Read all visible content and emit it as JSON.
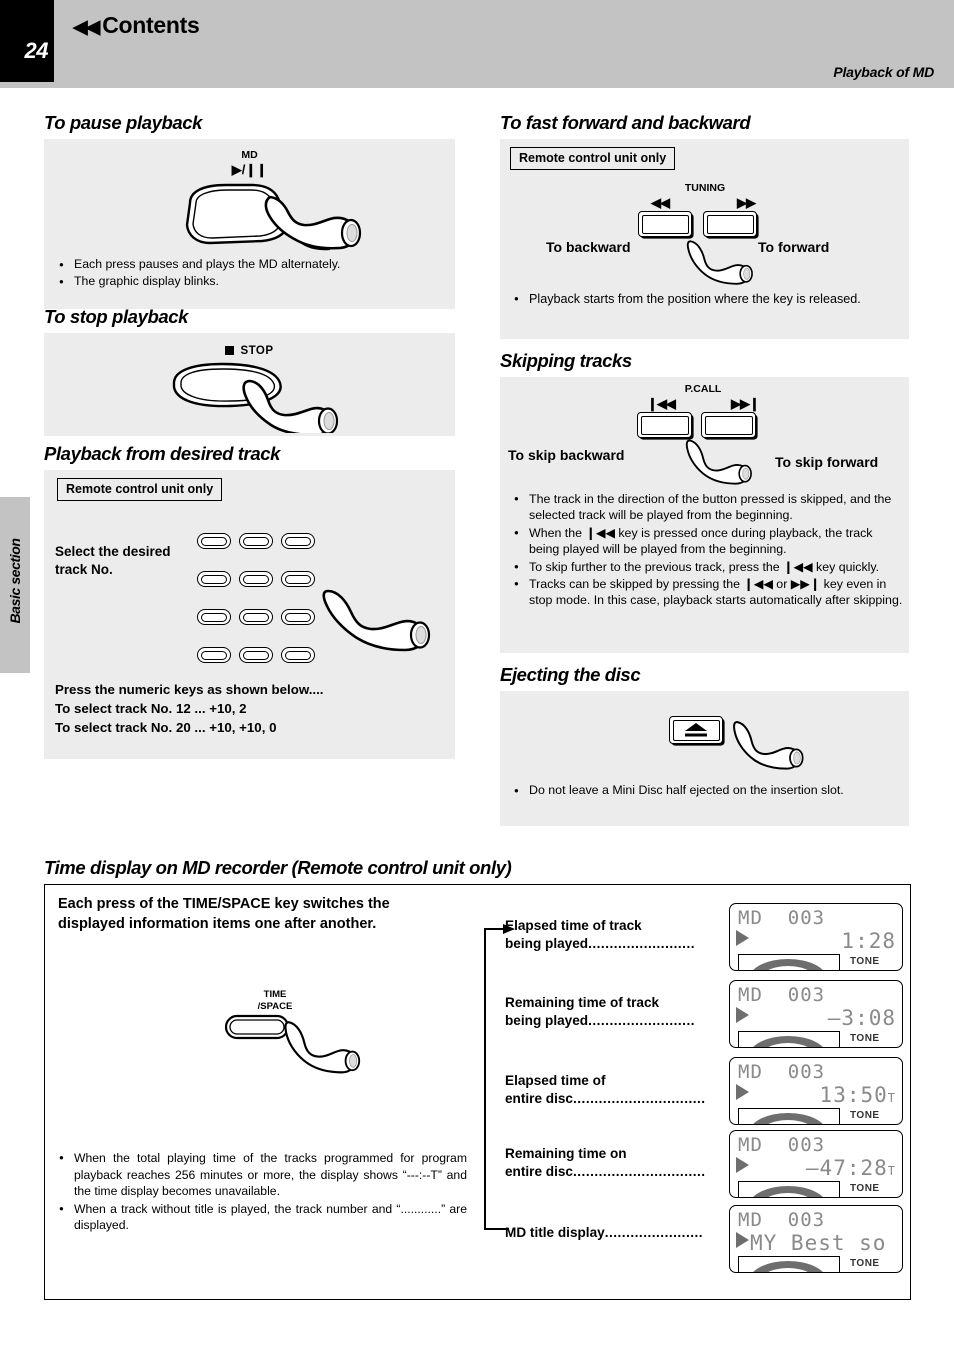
{
  "header": {
    "page_number": "24",
    "back_icon": "rewind-icon",
    "contents_label": "Contents",
    "section_title": "Playback of MD"
  },
  "side_tab": {
    "label": "Basic section"
  },
  "sections": {
    "pause": {
      "heading": "To pause playback",
      "button_top_label": "MD",
      "button_sub_label": "▶/❙❙",
      "bullets": [
        "Each press pauses and plays the MD alternately.",
        "The graphic display blinks."
      ]
    },
    "stop": {
      "heading": "To stop playback",
      "button_label": "STOP",
      "button_icon": "stop-square-icon"
    },
    "desired_track": {
      "heading": "Playback from desired track",
      "badge": "Remote control unit only",
      "select_label_line1": "Select the desired",
      "select_label_line2": "track No.",
      "note_line1": "Press the numeric keys as shown below....",
      "note_line2": "To select track No. 12 ... +10, 2",
      "note_line3": "To select track No. 20 ... +10, +10, 0",
      "keypad_rows": 4,
      "keypad_cols": 3
    },
    "fast_forward": {
      "heading": "To fast forward and backward",
      "badge": "Remote control unit only",
      "group_label": "TUNING",
      "left_icon": "◀◀",
      "right_icon": "▶▶",
      "left_label": "To backward",
      "right_label": "To forward",
      "bullets": [
        "Playback starts from the position where the key is released."
      ]
    },
    "skipping": {
      "heading": "Skipping tracks",
      "group_label": "P.CALL",
      "left_icon": "❙◀◀",
      "right_icon": "▶▶❙",
      "left_label": "To skip backward",
      "right_label": "To skip forward",
      "bullets": [
        "The track in the direction of the button pressed is skipped, and the selected track will be played from  the beginning.",
        "When the ❙◀◀ key is pressed once during playback, the track being played will be played from the beginning.",
        "To skip further to the previous track, press the ❙◀◀ key quickly.",
        "Tracks can be skipped by pressing the ❙◀◀ or ▶▶❙ key even in stop mode. In this case, playback starts automatically after skipping."
      ]
    },
    "eject": {
      "heading": "Ejecting the disc",
      "button_icon": "eject-icon",
      "bullets": [
        "Do not leave a Mini Disc half ejected on the insertion slot."
      ]
    },
    "time_display": {
      "heading": "Time display on MD recorder  (Remote control unit only)",
      "intro_line1": "Each press of the TIME/SPACE key switches the",
      "intro_line2": "displayed information items one after another.",
      "button_label_line1": "TIME",
      "button_label_line2": "/SPACE",
      "bullets": [
        "When the total playing time of the tracks programmed for program playback reaches 256 minutes or more, the display shows “---:--T” and the time display becomes unavailable.",
        "When a track without title is played, the track number and “............” are displayed."
      ],
      "items": [
        {
          "label_line1": "Elapsed time of track",
          "label_line2": "being played",
          "dots": ".........................",
          "lcd": {
            "row1": "MD  003",
            "value": "1:28",
            "suffix": "",
            "tone": "TONE"
          }
        },
        {
          "label_line1": "Remaining time of track",
          "label_line2": "being played",
          "dots": ".........................",
          "lcd": {
            "row1": "MD  003",
            "value": "–3:08",
            "suffix": "",
            "tone": "TONE"
          }
        },
        {
          "label_line1": "Elapsed time of",
          "label_line2": "entire disc",
          "dots": "...............................",
          "lcd": {
            "row1": "MD  003",
            "value": "13:50",
            "suffix": "T",
            "tone": "TONE"
          }
        },
        {
          "label_line1": "Remaining time on",
          "label_line2": "entire disc",
          "dots": "...............................",
          "lcd": {
            "row1": "MD  003",
            "value": "–47:28",
            "suffix": "T",
            "tone": "TONE"
          }
        },
        {
          "label_line1": "MD title display",
          "label_line2": "",
          "dots": ".......................",
          "lcd": {
            "row1": "MD  003",
            "title": "MY Best so",
            "tone": "TONE"
          }
        }
      ]
    }
  },
  "colors": {
    "header_gray": "#c3c3c3",
    "panel_gray": "#ececec",
    "ink": "#000000",
    "lcd_text": "#8a8a8a"
  }
}
